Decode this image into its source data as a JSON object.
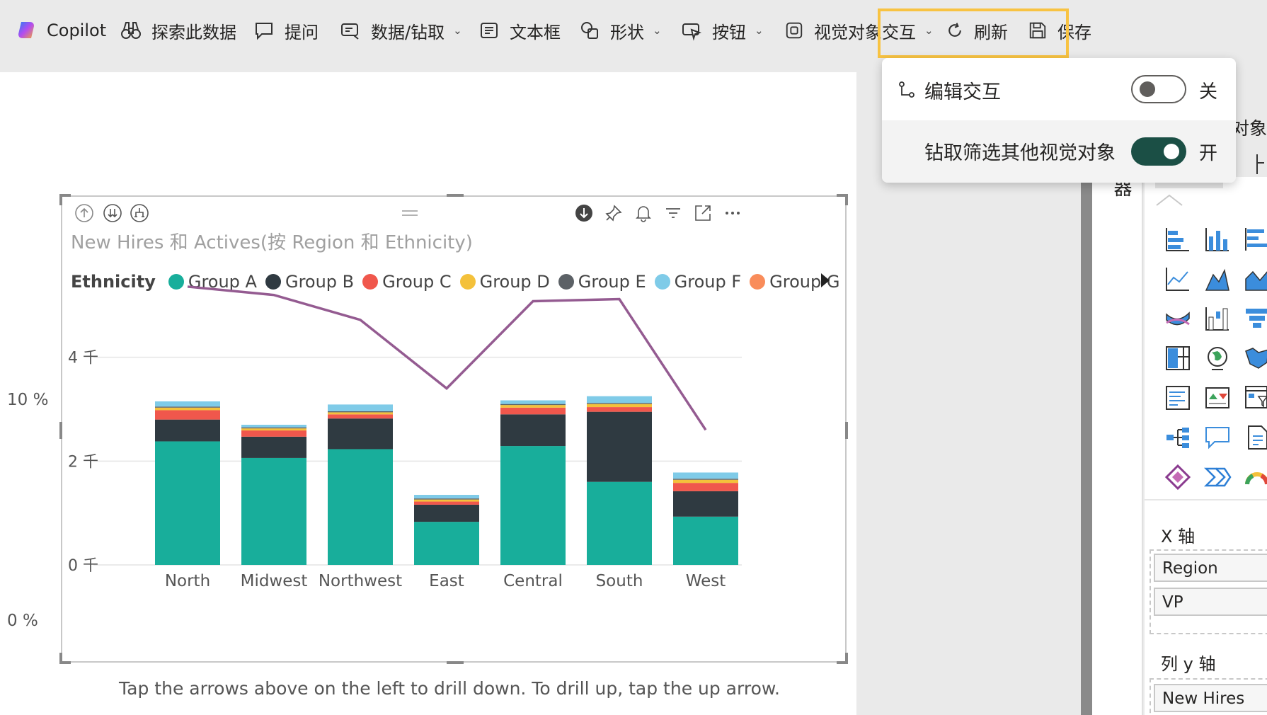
{
  "toolbar": {
    "items": [
      {
        "label": "Copilot",
        "icon": "copilot-icon"
      },
      {
        "label": "探索此数据",
        "icon": "binoculars-icon"
      },
      {
        "label": "提问",
        "icon": "chat-bubble-icon"
      },
      {
        "label": "数据/钻取",
        "icon": "data-drill-icon"
      },
      {
        "label": "文本框",
        "icon": "textbox-icon"
      },
      {
        "label": "形状",
        "icon": "shapes-icon"
      },
      {
        "label": "按钮",
        "icon": "button-icon"
      },
      {
        "label": "视觉对象交互",
        "icon": "visual-interaction-icon"
      },
      {
        "label": "刷新",
        "icon": "refresh-icon"
      },
      {
        "label": "保存",
        "icon": "save-icon"
      }
    ],
    "highlight_color": "#f8c342"
  },
  "flyout": {
    "edit_label": "编辑交互",
    "edit_state": "关",
    "drill_label": "钻取筛选其他视觉对象",
    "drill_state": "开",
    "toggle_on_color": "#1b4f45"
  },
  "visual": {
    "title": "New Hires 和 Actives(按 Region 和 Ethnicity)",
    "legend_title": "Ethnicity",
    "caption": "Tap the arrows above on the left to drill down. To drill up, tap the up arrow."
  },
  "chart_data": {
    "type": "bar",
    "stacked": true,
    "categories": [
      "North",
      "Midwest",
      "Northwest",
      "East",
      "Central",
      "South",
      "West"
    ],
    "y_ticks": [
      "0 千",
      "2 千",
      "4 千"
    ],
    "ylim": [
      0,
      6000
    ],
    "y2_ticks": [
      "0 %",
      "10 %"
    ],
    "y2lim": [
      0,
      0.15
    ],
    "legend_position": "top-left",
    "grid": true,
    "series": [
      {
        "name": "Group A",
        "color": "#18ae9b",
        "values": [
          2380,
          2060,
          2230,
          830,
          2290,
          1600,
          930
        ]
      },
      {
        "name": "Group B",
        "color": "#2f3a41",
        "values": [
          420,
          410,
          590,
          330,
          610,
          1350,
          490
        ]
      },
      {
        "name": "Group C",
        "color": "#f0574c",
        "values": [
          180,
          120,
          80,
          60,
          130,
          90,
          160
        ]
      },
      {
        "name": "Group D",
        "color": "#f4c13b",
        "values": [
          50,
          40,
          40,
          40,
          50,
          60,
          60
        ]
      },
      {
        "name": "Group E",
        "color": "#5c6166",
        "values": [
          20,
          20,
          20,
          20,
          20,
          20,
          20
        ]
      },
      {
        "name": "Group F",
        "color": "#7fcbe8",
        "values": [
          100,
          50,
          130,
          70,
          70,
          130,
          120
        ]
      },
      {
        "name": "Group G",
        "color": "#f98c5a",
        "values": []
      }
    ],
    "line": {
      "color": "#945b91",
      "values": [
        0.134,
        0.13,
        0.118,
        0.085,
        0.127,
        0.128,
        0.065
      ]
    }
  },
  "panel": {
    "vertical_label": "器",
    "partial_text": "对象",
    "x_axis_label": "X 轴",
    "x_axis_fields": [
      "Region",
      "VP"
    ],
    "col_y_axis_label": "列 y 轴",
    "col_y_axis_fields": [
      "New Hires"
    ]
  }
}
